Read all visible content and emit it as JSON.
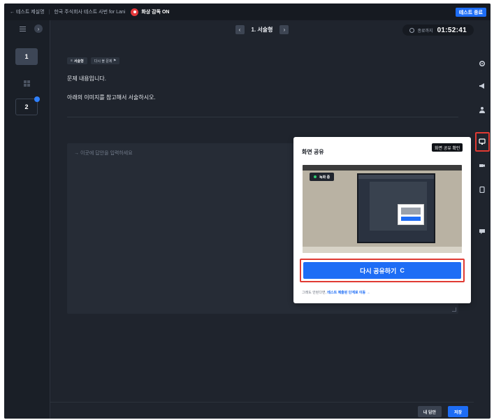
{
  "topbar": {
    "back_label": "← 테스트 제실명",
    "exam_title": "한국 주식회사 테스트 사번 for Lani",
    "proctor_status": "화상 감독 ON",
    "end_button": "테스트 종료"
  },
  "leftrail": {
    "questions": [
      {
        "number": "1",
        "active": true
      },
      {
        "number": "2",
        "active": false,
        "has_badge": true
      }
    ]
  },
  "question_nav": {
    "prev_icon": "chevron-left-icon",
    "title": "1. 서술형",
    "next_icon": "chevron-right-icon"
  },
  "timer": {
    "label": "종료까지",
    "value": "01:52:41"
  },
  "question": {
    "type_tag": "서술형",
    "revisit_tag": "다시 볼 문제",
    "line1": "문제 내용입니다.",
    "line2": "아래의 이미지를 참고해서 서술하시오."
  },
  "answer": {
    "placeholder": "→ 이곳에 답안을 입력하세요"
  },
  "bottombar": {
    "my_answer": "내 답안",
    "save": "저장"
  },
  "right_tools": [
    "gear-icon",
    "megaphone-icon",
    "person-icon",
    "monitor-icon",
    "camera-icon",
    "clipboard-icon",
    "chat-icon"
  ],
  "tooltip": {
    "text": "화면 공유 확인"
  },
  "share_popup": {
    "title": "화면 공유",
    "close": "×",
    "preview_badge": "녹화 중",
    "reshare_button": "다시 공유하기",
    "refresh_glyph": "C",
    "hint_prefix": "그래도 안된다면,",
    "hint_link": "테스트 제출된 단계로 이동 →"
  },
  "colors": {
    "accent": "#1e6df5",
    "highlight": "#e03a33",
    "background": "#1f242d"
  }
}
